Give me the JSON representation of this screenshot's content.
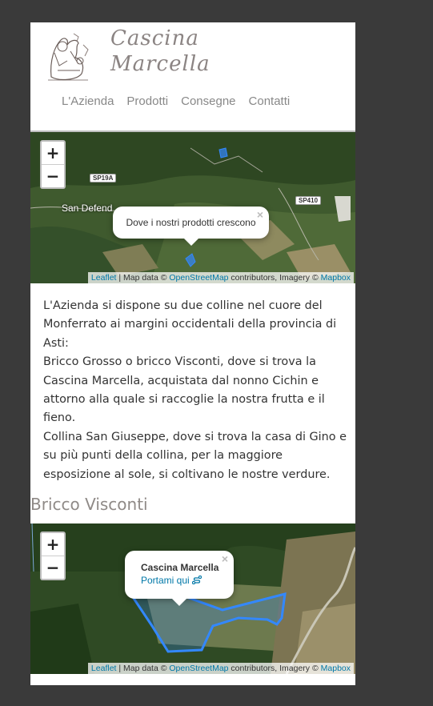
{
  "brand": {
    "line1": "Cascina",
    "line2": "Marcella"
  },
  "nav": [
    "L'Azienda",
    "Prodotti",
    "Consegne",
    "Contatti"
  ],
  "map1": {
    "zoom_in": "+",
    "zoom_out": "−",
    "labels": {
      "road1": "SP19A",
      "road2": "SP410",
      "place": "San Defend"
    },
    "popup": {
      "text": "Dove i nostri prodotti crescono",
      "close": "×"
    },
    "attribution": {
      "leaflet": "Leaflet",
      "sep": " | Map data © ",
      "osm": "OpenStreetMap",
      "mid": " contributors, Imagery © ",
      "mapbox": "Mapbox"
    }
  },
  "intro": {
    "p1": "L'Azienda si dispone su due colline nel cuore del Monferrato ai margini occidentali della provincia di Asti:",
    "p2": "Bricco Grosso o bricco Visconti, dove si trova la Cascina Marcella, acquistata dal nonno Cichin e attorno alla quale si raccoglie la nostra frutta e il fieno.",
    "p3": "Collina San Giuseppe, dove si trova la casa di Gino e su più punti della collina, per la maggiore esposizione al sole, si coltivano le nostre verdure."
  },
  "section_title": "Bricco Visconti",
  "map2": {
    "zoom_in": "+",
    "zoom_out": "−",
    "popup": {
      "title": "Cascina Marcella",
      "link": "Portami qui",
      "close": "×"
    },
    "attribution": {
      "leaflet": "Leaflet",
      "sep": " | Map data © ",
      "osm": "OpenStreetMap",
      "mid": " contributors, Imagery © ",
      "mapbox": "Mapbox"
    }
  },
  "colors": {
    "background": "#3a3a3a",
    "accent_link": "#0078a8",
    "brand_text": "#8b8483",
    "polygon": "#3388ff"
  }
}
